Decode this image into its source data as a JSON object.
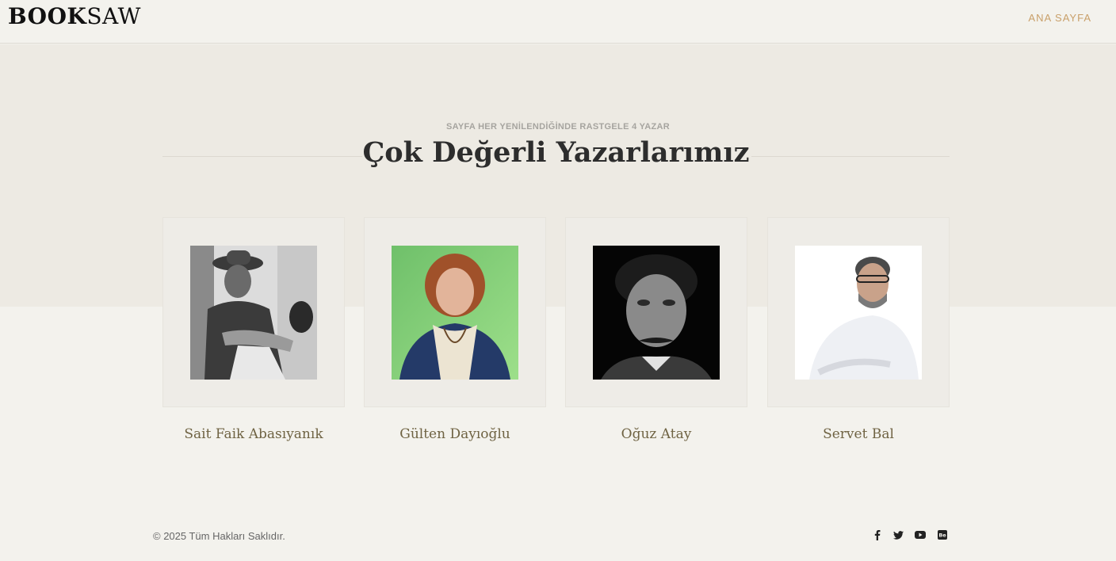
{
  "header": {
    "logo_bold": "BOOK",
    "logo_thin": "SAW",
    "nav_home": "ANA SAYFA"
  },
  "section": {
    "subtitle": "SAYFA HER YENİLENDİĞİNDE RASTGELE 4 YAZAR",
    "title": "Çok Değerli Yazarlarımız"
  },
  "authors": [
    {
      "name": "Sait Faik Abasıyanık"
    },
    {
      "name": "Gülten Dayıoğlu"
    },
    {
      "name": "Oğuz Atay"
    },
    {
      "name": "Servet Bal"
    }
  ],
  "footer": {
    "copyright": "© 2025 Tüm Hakları Saklıdır.",
    "social_icons": [
      "facebook-icon",
      "twitter-icon",
      "youtube-icon",
      "behance-icon"
    ]
  },
  "colors": {
    "accent": "#c9a06a",
    "author_name": "#6f6343",
    "hero_bg": "#edeae3",
    "page_bg": "#f3f2ed"
  }
}
